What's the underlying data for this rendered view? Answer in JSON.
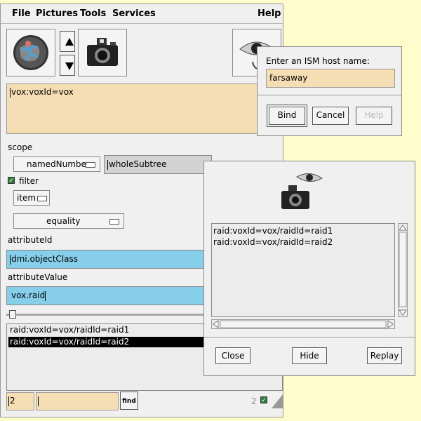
{
  "menu": {
    "file": "File",
    "pictures": "Pictures",
    "tools": "Tools",
    "services": "Services",
    "help": "Help"
  },
  "search": {
    "filter_text": "vox:voxId=vox"
  },
  "scope": {
    "label": "scope",
    "option": "namedNumbers",
    "value": "wholeSubtree"
  },
  "filter": {
    "label": "filter",
    "checked": true,
    "item": "item",
    "match": "equality"
  },
  "attributeId": {
    "label": "attributeId",
    "value": "dmi.objectClass"
  },
  "attributeValue": {
    "label": "attributeValue",
    "value": "vox.raid"
  },
  "results": [
    "raid:voxId=vox/raidId=raid1",
    "raid:voxId=vox/raidId=raid2"
  ],
  "selected_result_index": 1,
  "bottom": {
    "count_value": "2",
    "find_label": "find",
    "status_count": "2"
  },
  "host_dialog": {
    "prompt": "Enter an ISM host name:",
    "host_value": "farsaway",
    "bind": "Bind",
    "cancel": "Cancel",
    "help": "Help"
  },
  "result_dialog": {
    "items": [
      "raid:voxId=vox/raidId=raid1",
      "raid:voxId=vox/raidId=raid2"
    ],
    "close": "Close",
    "hide": "Hide",
    "replay": "Replay"
  }
}
